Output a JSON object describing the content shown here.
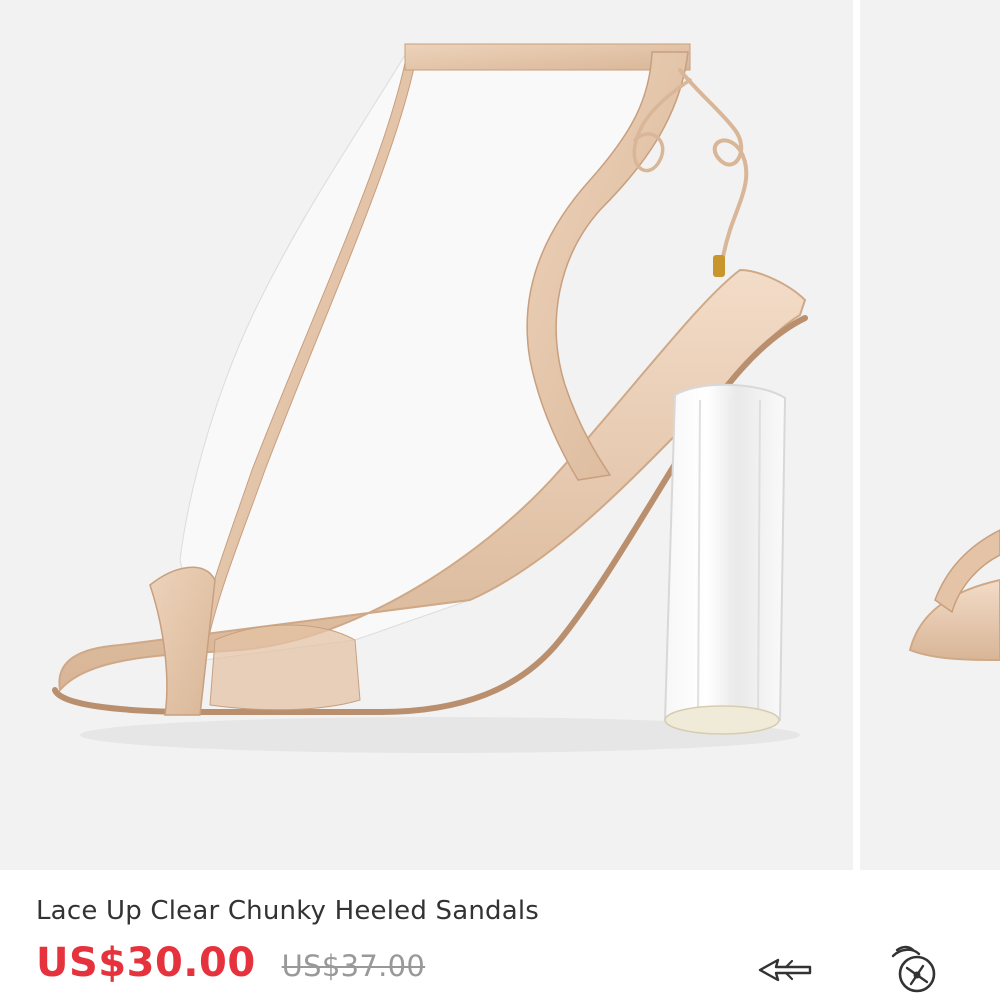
{
  "product": {
    "title": "Lace Up Clear Chunky Heeled Sandals",
    "price": "US$30.00",
    "original_price": "US$37.00",
    "images": [
      {
        "alt": "product-photo-main"
      },
      {
        "alt": "product-photo-next"
      }
    ]
  },
  "actions": [
    {
      "name": "share-icon"
    },
    {
      "name": "favorite-icon"
    }
  ],
  "colors": {
    "price": "#e5323c",
    "original_price": "#999999",
    "title": "#333333",
    "photo_background": "#f2f2f2",
    "nude_strap": "#e8c9ad"
  }
}
